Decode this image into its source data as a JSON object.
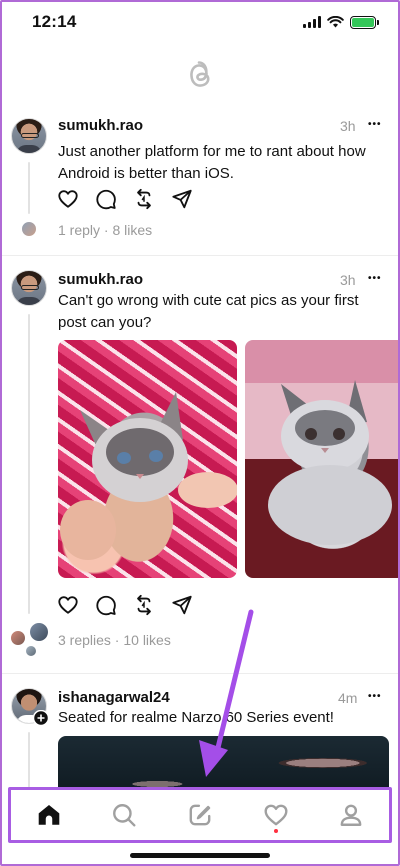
{
  "status_bar": {
    "time": "12:14",
    "battery_color": "#34c759",
    "icons": [
      "signal-icon",
      "wifi-icon",
      "battery-charging-icon"
    ]
  },
  "app": {
    "logo_icon": "threads-logo-icon"
  },
  "posts": [
    {
      "username": "sumukh.rao",
      "time": "3h",
      "more": "•••",
      "text": "Just another platform for me to rant about how Android is better than iOS.",
      "meta": "1 reply · 8 likes"
    },
    {
      "username": "sumukh.rao",
      "time": "3h",
      "more": "•••",
      "text": "Can't go wrong with cute cat pics as your first post can you?",
      "images": [
        "cat-photo-1",
        "cat-photo-2"
      ],
      "meta": "3 replies · 10 likes"
    },
    {
      "username": "ishanagarwal24",
      "time": "4m",
      "more": "•••",
      "text": "Seated for realme Narzo 60 Series event!",
      "images": [
        "event-photo"
      ]
    }
  ],
  "bottom_nav": {
    "items": [
      "home-icon",
      "search-icon",
      "compose-icon",
      "activity-heart-icon",
      "profile-icon"
    ],
    "active": "home-icon",
    "notification_dot_color": "#ff3040",
    "highlight_color": "#a85de3"
  }
}
